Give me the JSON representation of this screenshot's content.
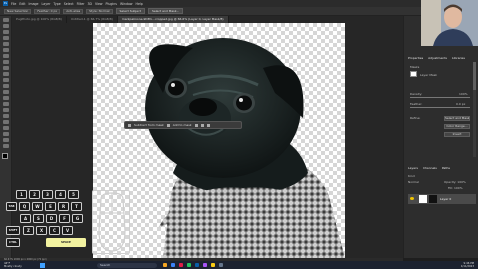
{
  "menubar": {
    "logo": "Ps",
    "items": [
      "File",
      "Edit",
      "Image",
      "Layer",
      "Type",
      "Select",
      "Filter",
      "3D",
      "View",
      "Plugins",
      "Window",
      "Help"
    ]
  },
  "options": {
    "tool_mode": "New Selection",
    "feather": "Feather: 0 px",
    "antialias": "Anti-alias",
    "style": "Style: Normal",
    "select_subject": "Select Subject",
    "select_mask": "Select and Mask..."
  },
  "tabs": [
    {
      "label": "PugPhoto.jpg @ 100% (RGB/8)"
    },
    {
      "label": "Untitled-1 @ 66.7% (RGB/8)"
    },
    {
      "label": "markpalinone-9h8fo...cropped.jpg @ 66.6% (Layer 0, Layer Mask/8)",
      "active": true
    }
  ],
  "context_bar": {
    "subtract": "Subtract from mask",
    "add": "Add to mask"
  },
  "keypad": {
    "row1": [
      "1",
      "2",
      "3",
      "4",
      "5"
    ],
    "row2": [
      "TAB",
      "Q",
      "W",
      "E",
      "R",
      "T"
    ],
    "row3": [
      "A",
      "S",
      "D",
      "F",
      "G"
    ],
    "row4": [
      "SHIFT",
      "Z",
      "X",
      "C",
      "V"
    ],
    "row5": [
      "CTRL",
      "SPACE"
    ]
  },
  "panel": {
    "properties_tabs": [
      "Properties",
      "Adjustments",
      "Libraries"
    ],
    "section": "Masks",
    "layer_mask": "Layer Mask",
    "density": "Density:",
    "density_val": "100%",
    "feather": "Feather:",
    "feather_val": "0.0 px",
    "refine": "Refine:",
    "select_mask_btn": "Select and Mask...",
    "color_range_btn": "Color Range...",
    "invert_btn": "Invert",
    "layers_tabs": [
      "Layers",
      "Channels",
      "Paths"
    ],
    "kind": "Kind",
    "blend": "Normal",
    "opacity": "Opacity: 100%",
    "fill": "Fill: 100%",
    "layer_name": "Layer 0"
  },
  "status": {
    "zoom": "66.67%",
    "dims": "2000 px x 2000 px (72 ppi)"
  },
  "taskbar": {
    "weather_temp": "44°F",
    "weather_desc": "Mostly cloudy",
    "search": "Search",
    "time": "9:46 PM",
    "date": "1/11/2023"
  },
  "colors": {
    "accent": "#0a5fa8",
    "highlight_key": "#f2f2a0",
    "eye": "#f0c400"
  }
}
